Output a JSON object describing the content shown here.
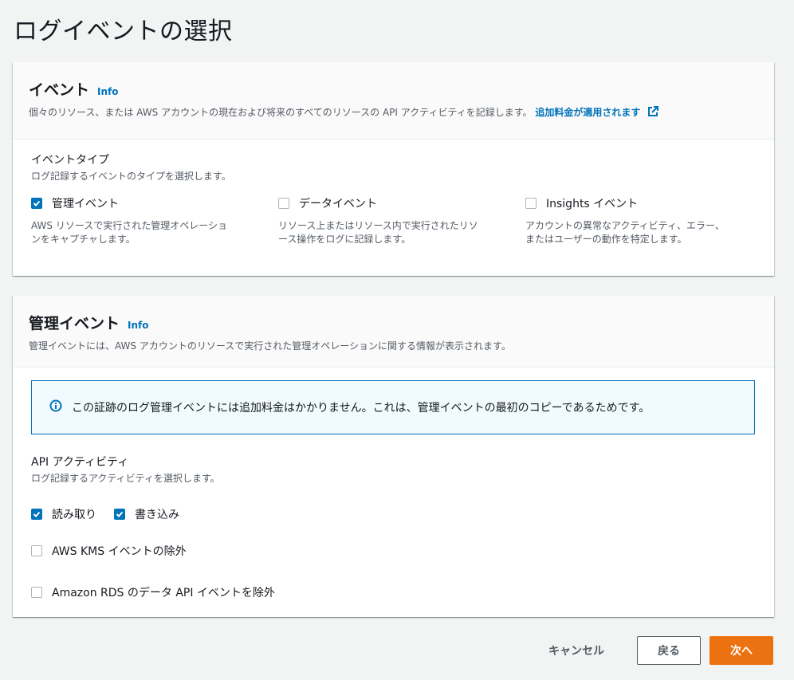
{
  "page": {
    "title": "ログイベントの選択"
  },
  "events_panel": {
    "title": "イベント",
    "info": "Info",
    "description": "個々のリソース、または AWS アカウントの現在および将来のすべてのリソースの API アクティビティを記録します。",
    "link": "追加料金が適用されます",
    "event_type": {
      "label": "イベントタイプ",
      "description": "ログ記録するイベントのタイプを選択します。",
      "options": [
        {
          "label": "管理イベント",
          "checked": true,
          "desc_line1": "AWS リソースで実行された管理オペレーショ",
          "desc_line2": "ンをキャプチャします。"
        },
        {
          "label": "データイベント",
          "checked": false,
          "desc_line1": "リソース上またはリソース内で実行されたリソ",
          "desc_line2": "ース操作をログに記録します。"
        },
        {
          "label": "Insights イベント",
          "checked": false,
          "desc_line1": "アカウントの異常なアクティビティ、エラー、",
          "desc_line2": "またはユーザーの動作を特定します。"
        }
      ]
    }
  },
  "mgmt_panel": {
    "title": "管理イベント",
    "info": "Info",
    "description": "管理イベントには、AWS アカウントのリソースで実行された管理オペレーションに関する情報が表示されます。",
    "alert": "この証跡のログ管理イベントには追加料金はかかりません。これは、管理イベントの最初のコピーであるためです。",
    "api_activity": {
      "label": "API アクティビティ",
      "description": "ログ記録するアクティビティを選択します。",
      "read": {
        "label": "読み取り",
        "checked": true
      },
      "write": {
        "label": "書き込み",
        "checked": true
      }
    },
    "exclude_kms": {
      "label": "AWS KMS イベントの除外",
      "checked": false
    },
    "exclude_rds": {
      "label": "Amazon RDS のデータ API イベントを除外",
      "checked": false
    }
  },
  "footer": {
    "cancel": "キャンセル",
    "back": "戻る",
    "next": "次へ"
  },
  "colors": {
    "accent": "#0073bb",
    "primary_button": "#ec7211",
    "background": "#f2f3f3"
  }
}
